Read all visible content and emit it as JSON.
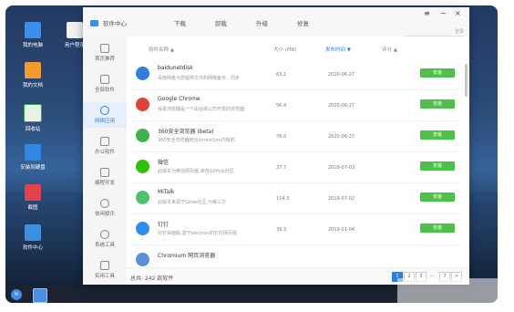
{
  "desktop": {
    "icons": [
      {
        "label": "我的电脑"
      },
      {
        "label": "用户程序"
      },
      {
        "label": "我的文档"
      },
      {
        "label": "回收站"
      },
      {
        "label": "安装到硬盘"
      },
      {
        "label": "截图"
      },
      {
        "label": "软件中心"
      }
    ]
  },
  "taskbar": {
    "start_label": "N"
  },
  "window": {
    "app_title": "软件中心",
    "tabs": [
      "下载",
      "卸载",
      "升级",
      "修复"
    ],
    "controls": {
      "menu": "≡",
      "minimize": "−",
      "close": "×"
    },
    "search_label": "登录"
  },
  "sidebar": {
    "items": [
      {
        "label": "首页推荐"
      },
      {
        "label": "全部软件"
      },
      {
        "label": "网络应用"
      },
      {
        "label": "办公软件"
      },
      {
        "label": "编程开发"
      },
      {
        "label": "休闲娱乐"
      },
      {
        "label": "系统工具"
      },
      {
        "label": "实用工具"
      }
    ]
  },
  "table": {
    "headers": {
      "name": "软件名称 ▲",
      "size": "大小 (MB)",
      "date": "发布时间 ▼",
      "rating": "评分 ▲"
    },
    "rows": [
      {
        "name": "baidunetdisk",
        "desc": "百度网盘为您提供文件的网络备份、同步",
        "size": "63.1",
        "date": "2020-06-27",
        "action": "安装",
        "icon_color": "#2f7fe3"
      },
      {
        "name": "Google Chrome",
        "desc": "谷歌浏览器是一个由谷歌公司开发的浏览器",
        "size": "56.4",
        "date": "2020-06-27",
        "action": "安装",
        "icon_color": "#db4437"
      },
      {
        "name": "360安全浏览器 (beta)",
        "desc": "360安全浏览器结合chromium内核的",
        "size": "76.0",
        "date": "2020-06-27",
        "action": "安装",
        "icon_color": "#3fb34f"
      },
      {
        "name": "微信",
        "desc": "此版本为微信网页版,来自GitHub社区",
        "size": "37.7",
        "date": "2019-07-03",
        "action": "安装",
        "icon_color": "#2dc100"
      },
      {
        "name": "MiTalk",
        "desc": "此版本来源于Gitee社区,为第三方",
        "size": "114.3",
        "date": "2019-07-02",
        "action": "安装",
        "icon_color": "#4cc36b"
      },
      {
        "name": "钉钉",
        "desc": "钉钉桌面版,基于electron的钉钉网页版",
        "size": "39.3",
        "date": "2019-01-04",
        "action": "安装",
        "icon_color": "#2c8ff0"
      },
      {
        "name": "Chromium 网页浏览器",
        "desc": "",
        "size": "",
        "date": "",
        "action": "",
        "icon_color": "#5b8fd9"
      }
    ]
  },
  "footer": {
    "total": "总共: 242 款软件",
    "pages": [
      "1",
      "2",
      "3",
      "...",
      "7",
      ">"
    ]
  }
}
